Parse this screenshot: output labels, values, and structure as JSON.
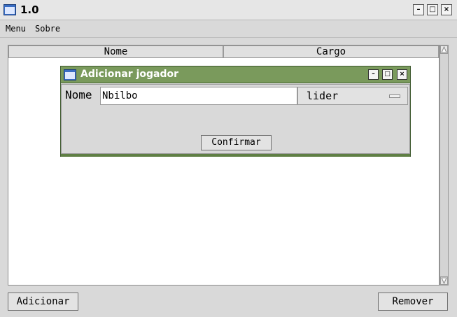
{
  "window": {
    "title": "1.0",
    "minimize": "–",
    "maximize": "□",
    "close": "×"
  },
  "menubar": {
    "items": [
      "Menu",
      "Sobre"
    ]
  },
  "table": {
    "columns": [
      "Nome",
      "Cargo"
    ]
  },
  "buttons": {
    "add": "Adicionar",
    "remove": "Remover"
  },
  "dialog": {
    "title": "Adicionar jogador",
    "name_label": "Nome",
    "name_value": "Nbilbo",
    "cargo_value": "lider",
    "confirm": "Confirmar",
    "minimize": "–",
    "maximize": "□",
    "close": "×"
  },
  "colors": {
    "dialog_titlebar": "#7a9a5c",
    "background": "#d9d9d9"
  }
}
